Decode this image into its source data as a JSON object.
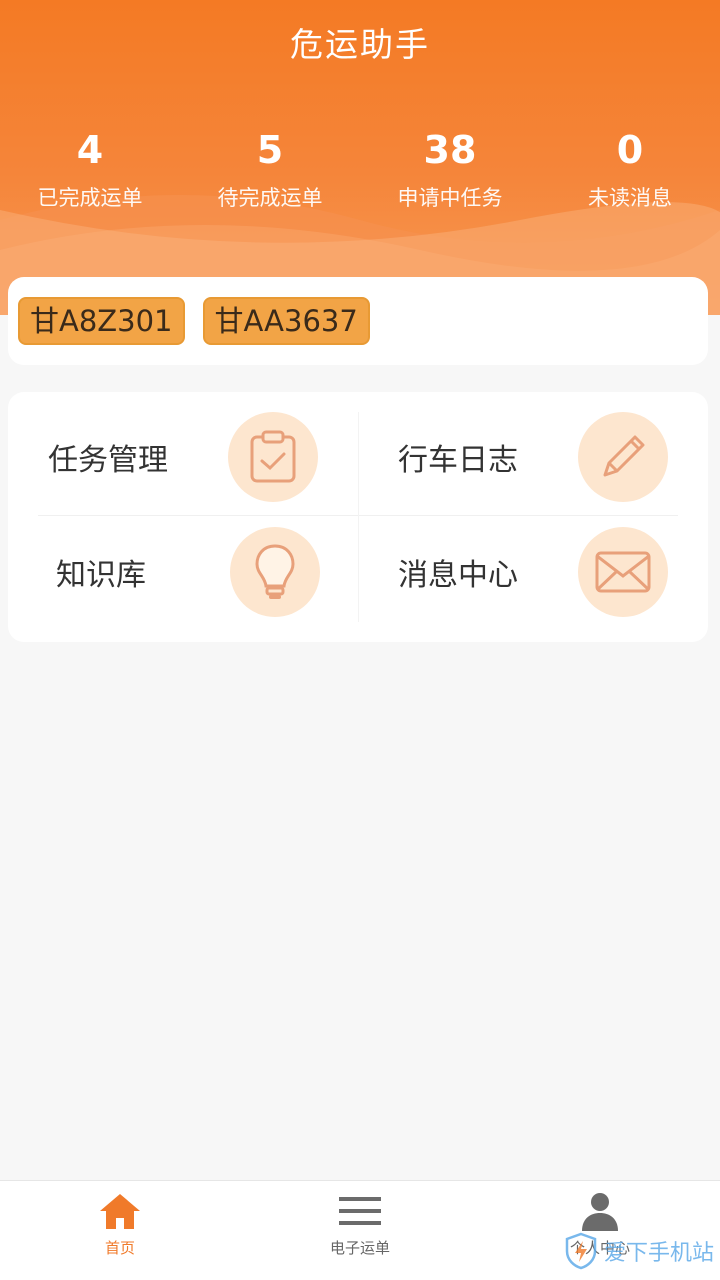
{
  "header": {
    "title": "危运助手"
  },
  "stats": [
    {
      "value": "4",
      "label": "已完成运单"
    },
    {
      "value": "5",
      "label": "待完成运单"
    },
    {
      "value": "38",
      "label": "申请中任务"
    },
    {
      "value": "0",
      "label": "未读消息"
    }
  ],
  "plates": [
    "甘A8Z301",
    "甘AA3637"
  ],
  "features": [
    {
      "label": "任务管理",
      "icon": "clipboard-check-icon"
    },
    {
      "label": "行车日志",
      "icon": "pencil-icon"
    },
    {
      "label": "知识库",
      "icon": "lightbulb-icon"
    },
    {
      "label": "消息中心",
      "icon": "envelope-icon"
    }
  ],
  "nav": [
    {
      "label": "首页",
      "icon": "home-icon",
      "active": true
    },
    {
      "label": "电子运单",
      "icon": "menu-lines-icon",
      "active": false
    },
    {
      "label": "个人中心",
      "icon": "person-icon",
      "active": false
    }
  ],
  "watermark": {
    "text": "爱下手机站"
  },
  "colors": {
    "accent": "#f47a24",
    "icon_bg": "#fde6cf",
    "plate": "#f2a446"
  }
}
